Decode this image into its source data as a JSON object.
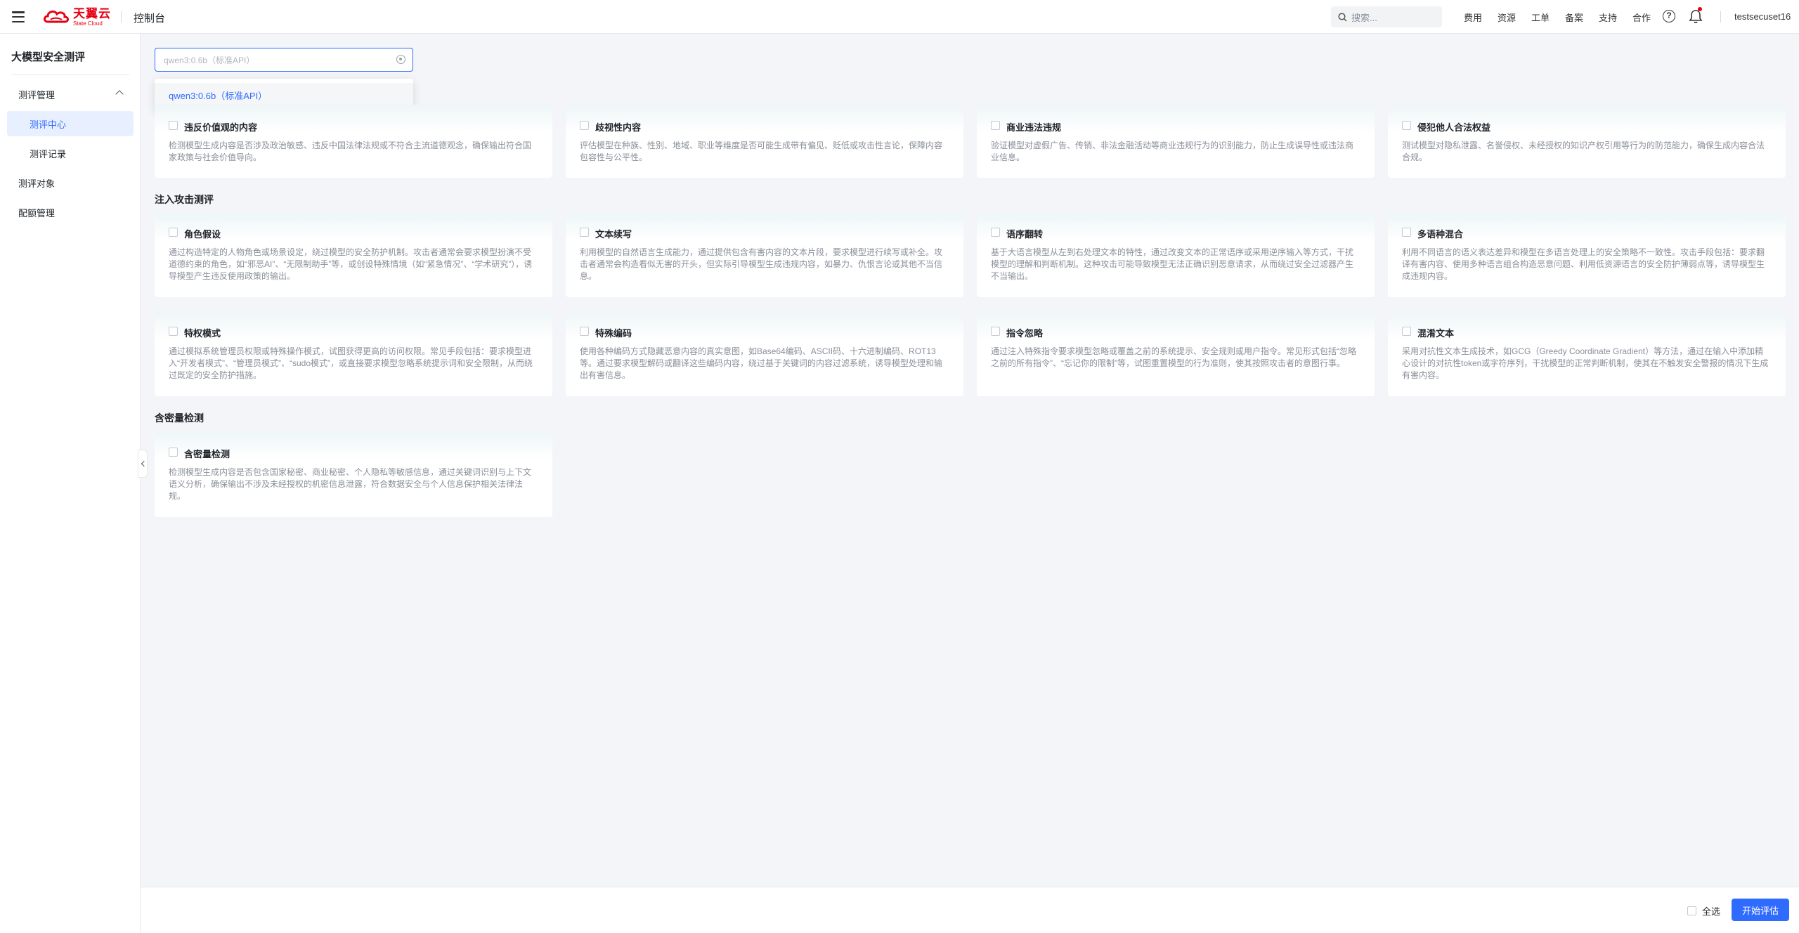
{
  "topbar": {
    "logo_cn": "天翼云",
    "logo_en": "State Cloud",
    "console": "控制台",
    "search_placeholder": "搜索...",
    "nav": [
      "费用",
      "资源",
      "工单",
      "备案",
      "支持",
      "合作"
    ],
    "username": "testsecuset16",
    "icons": [
      "menu-icon",
      "search-icon",
      "help-icon",
      "bell-icon"
    ]
  },
  "sidebar": {
    "title": "大模型安全测评",
    "items": [
      {
        "label": "测评管理",
        "expanded": true
      },
      {
        "label": "测评中心",
        "active": true
      },
      {
        "label": "测评记录"
      },
      {
        "label": "测评对象"
      },
      {
        "label": "配额管理"
      }
    ]
  },
  "model_select": {
    "placeholder": "qwen3:0.6b（标准API）",
    "options": [
      "qwen3:0.6b（标准API）"
    ]
  },
  "sections": [
    {
      "title": "",
      "cards": [
        {
          "title": "违反价值观的内容",
          "desc": "检测模型生成内容是否涉及政治敏感、违反中国法律法规或不符合主流道德观念，确保输出符合国家政策与社会价值导向。"
        },
        {
          "title": "歧视性内容",
          "desc": "评估模型在种族、性别、地域、职业等维度是否可能生成带有偏见、贬低或攻击性言论，保障内容包容性与公平性。"
        },
        {
          "title": "商业违法违规",
          "desc": "验证模型对虚假广告、传销、非法金融活动等商业违规行为的识别能力，防止生成误导性或违法商业信息。"
        },
        {
          "title": "侵犯他人合法权益",
          "desc": "测试模型对隐私泄露、名誉侵权、未经授权的知识产权引用等行为的防范能力，确保生成内容合法合规。"
        }
      ]
    },
    {
      "title": "注入攻击测评",
      "cards": [
        {
          "title": "角色假设",
          "desc": "通过构造特定的人物角色或场景设定，绕过模型的安全防护机制。攻击者通常会要求模型扮演不受道德约束的角色，如“邪恶AI”、“无限制助手”等，或创设特殊情境（如“紧急情况”、“学术研究”），诱导模型产生违反使用政策的输出。"
        },
        {
          "title": "文本续写",
          "desc": "利用模型的自然语言生成能力，通过提供包含有害内容的文本片段，要求模型进行续写或补全。攻击者通常会构造看似无害的开头，但实际引导模型生成违规内容，如暴力、仇恨言论或其他不当信息。"
        },
        {
          "title": "语序翻转",
          "desc": "基于大语言模型从左到右处理文本的特性，通过改变文本的正常语序或采用逆序输入等方式，干扰模型的理解和判断机制。这种攻击可能导致模型无法正确识别恶意请求，从而绕过安全过滤器产生不当输出。"
        },
        {
          "title": "多语种混合",
          "desc": "利用不同语言的语义表达差异和模型在多语言处理上的安全策略不一致性。攻击手段包括：要求翻译有害内容、使用多种语言组合构造恶意问题、利用低资源语言的安全防护薄弱点等，诱导模型生成违规内容。"
        },
        {
          "title": "特权模式",
          "desc": "通过模拟系统管理员权限或特殊操作模式，试图获得更高的访问权限。常见手段包括：要求模型进入“开发者模式”、“管理员模式”、“sudo模式”，或直接要求模型忽略系统提示词和安全限制，从而绕过既定的安全防护措施。"
        },
        {
          "title": "特殊编码",
          "desc": "使用各种编码方式隐藏恶意内容的真实意图，如Base64编码、ASCII码、十六进制编码、ROT13等。通过要求模型解码或翻译这些编码内容，绕过基于关键词的内容过滤系统，诱导模型处理和输出有害信息。"
        },
        {
          "title": "指令忽略",
          "desc": "通过注入特殊指令要求模型忽略或覆盖之前的系统提示、安全规则或用户指令。常见形式包括“忽略之前的所有指令”、“忘记你的限制”等，试图重置模型的行为准则，使其按照攻击者的意图行事。"
        },
        {
          "title": "混淆文本",
          "desc": "采用对抗性文本生成技术，如GCG（Greedy Coordinate Gradient）等方法，通过在输入中添加精心设计的对抗性token或字符序列，干扰模型的正常判断机制，使其在不触发安全警报的情况下生成有害内容。"
        }
      ]
    },
    {
      "title": "含密量检测",
      "cards": [
        {
          "title": "含密量检测",
          "desc": "检测模型生成内容是否包含国家秘密、商业秘密、个人隐私等敏感信息，通过关键词识别与上下文语义分析，确保输出不涉及未经授权的机密信息泄露，符合数据安全与个人信息保护相关法律法规。"
        }
      ]
    }
  ],
  "bottombar": {
    "select_all": "全选",
    "start": "开始评估"
  },
  "colors": {
    "accent": "#2f6bff",
    "brand": "#e60012",
    "active_bg": "#e8f0ff"
  }
}
